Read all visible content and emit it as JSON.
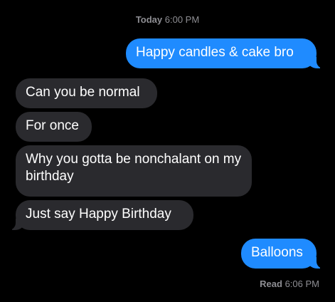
{
  "conversation": {
    "timestamp_day": "Today",
    "timestamp_time": "6:00 PM",
    "messages": [
      {
        "direction": "sent",
        "text": "Happy candles & cake bro"
      },
      {
        "direction": "received",
        "text": "Can you be normal"
      },
      {
        "direction": "received",
        "text": "For once"
      },
      {
        "direction": "received",
        "text": "Why you gotta be nonchalant on my birthday"
      },
      {
        "direction": "received",
        "text": "Just say Happy Birthday"
      },
      {
        "direction": "sent",
        "text": "Balloons"
      }
    ],
    "read_receipt_label": "Read",
    "read_receipt_time": "6:06 PM"
  },
  "colors": {
    "background": "#000000",
    "sent_bubble": "#1f8bff",
    "received_bubble": "#2a2a2e",
    "meta_text": "#8e8e93"
  }
}
